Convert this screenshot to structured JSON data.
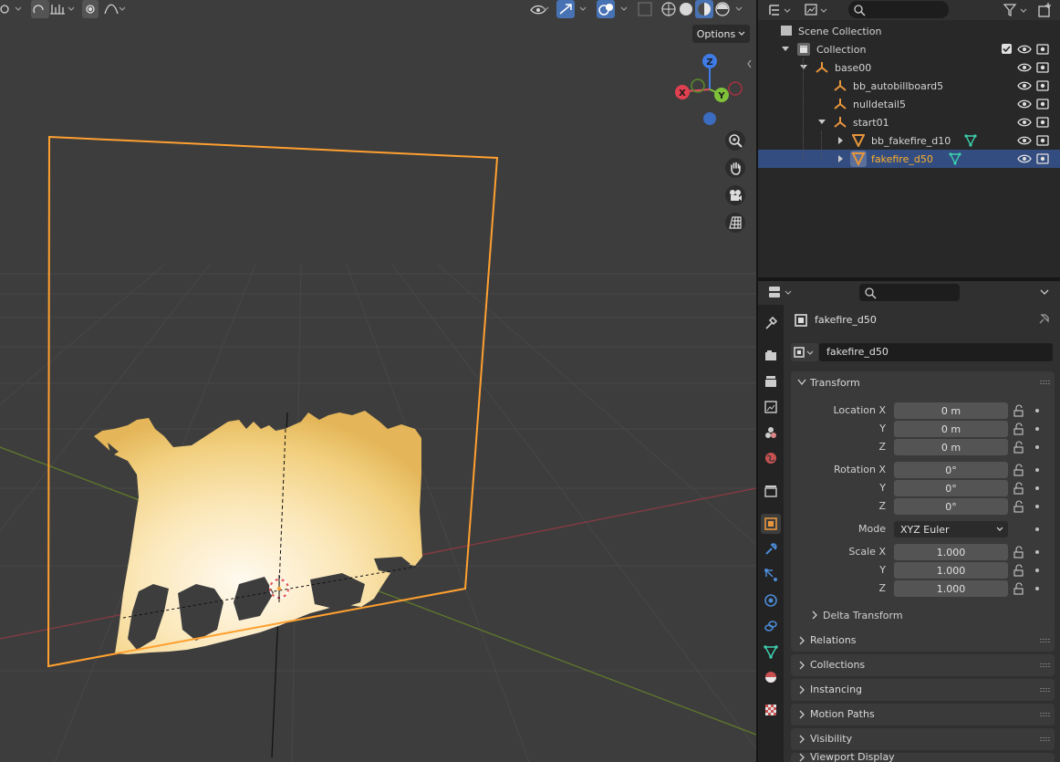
{
  "viewport": {
    "options_label": "Options",
    "gizmo": {
      "x": "X",
      "y": "Y",
      "z": "Z"
    },
    "nav_tools": [
      "zoom-icon",
      "hand-icon",
      "camera-icon",
      "grid-icon"
    ],
    "selected_color": "#ffa030"
  },
  "outliner": {
    "rows": [
      {
        "name": "Scene Collection",
        "icon": "scene-collection-icon"
      },
      {
        "name": "Collection",
        "icon": "collection-icon"
      },
      {
        "name": "base00",
        "icon": "empty-icon"
      },
      {
        "name": "bb_autobillboard5",
        "icon": "empty-icon"
      },
      {
        "name": "nulldetail5",
        "icon": "empty-icon"
      },
      {
        "name": "start01",
        "icon": "empty-icon"
      },
      {
        "name": "bb_fakefire_d10",
        "icon": "mesh-icon"
      },
      {
        "name": "fakefire_d50",
        "icon": "mesh-icon"
      }
    ]
  },
  "properties": {
    "object_name": "fakefire_d50",
    "datablock_name": "fakefire_d50",
    "transform": {
      "title": "Transform",
      "location_label": "Location X",
      "rotation_label": "Rotation X",
      "scale_label": "Scale X",
      "y_label": "Y",
      "z_label": "Z",
      "location": [
        "0 m",
        "0 m",
        "0 m"
      ],
      "rotation": [
        "0°",
        "0°",
        "0°"
      ],
      "mode_label": "Mode",
      "mode_value": "XYZ Euler",
      "scale": [
        "1.000",
        "1.000",
        "1.000"
      ],
      "delta": "Delta Transform"
    },
    "panels": [
      "Relations",
      "Collections",
      "Instancing",
      "Motion Paths",
      "Visibility",
      "Viewport Display"
    ]
  }
}
